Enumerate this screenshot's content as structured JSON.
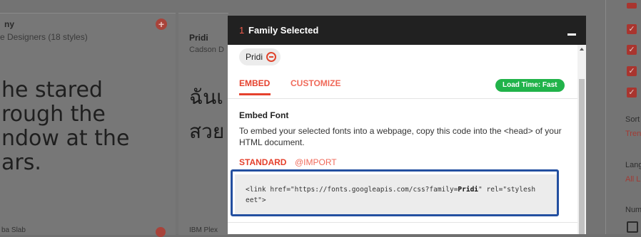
{
  "background": {
    "card1": {
      "title": "ny",
      "subtitle": "e Designers (18 styles)",
      "sample_text": "he stared\nrough the\nndow at the\nars.",
      "add_symbol": "+",
      "bottom_label": "ba Slab"
    },
    "card2": {
      "title": "Pridi",
      "subtitle": "Cadson D",
      "sample_text": "ฉันเ\nสวย",
      "bottom_label": "IBM Plex"
    },
    "filters": {
      "checkbox_mark": "✓",
      "sort_label": "Sort",
      "sort_value": "Tren",
      "language_label": "Lang",
      "language_value": "All L",
      "number_label": "Num"
    }
  },
  "drawer": {
    "count": "1",
    "title": "Family Selected",
    "chip_label": "Pridi",
    "tabs": [
      "EMBED",
      "CUSTOMIZE"
    ],
    "load_time": "Load Time: Fast",
    "embed_heading": "Embed Font",
    "embed_description": "To embed your selected fonts into a webpage, copy this code into the <head> of your HTML document.",
    "subtabs": [
      "STANDARD",
      "@IMPORT"
    ],
    "code": {
      "line1_prefix": "<link href=\"https://fonts.googleapis.com/css?family=",
      "line1_family": "Pridi",
      "line1_suffix": "\" rel=\"stylesh",
      "line2": "eet\">"
    }
  },
  "colors": {
    "accent_red": "#e5412d",
    "load_green": "#21b34a",
    "highlight_blue": "#234fa0"
  }
}
